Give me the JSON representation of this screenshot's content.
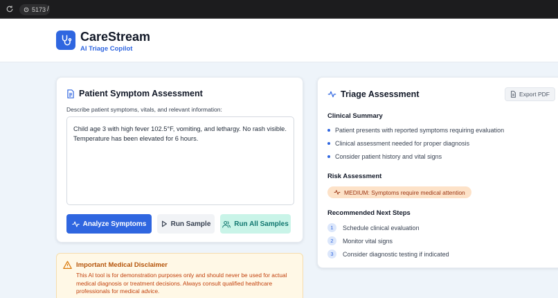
{
  "browser": {
    "port": "5173",
    "path": "/"
  },
  "header": {
    "title": "CareStream",
    "subtitle": "AI Triage Copilot"
  },
  "assessment_form": {
    "title": "Patient Symptom Assessment",
    "label": "Describe patient symptoms, vitals, and relevant information:",
    "input_value": "Child age 3 with high fever 102.5°F, vomiting, and lethargy. No rash visible. Temperature has been elevated for 6 hours.",
    "buttons": {
      "analyze": "Analyze Symptoms",
      "run_sample": "Run Sample",
      "run_all": "Run All Samples"
    }
  },
  "disclaimer": {
    "title": "Important Medical Disclaimer",
    "body": "This AI tool is for demonstration purposes only and should never be used for actual medical diagnosis or treatment decisions. Always consult qualified healthcare professionals for medical advice."
  },
  "triage": {
    "title": "Triage Assessment",
    "export_label": "Export PDF",
    "clinical_summary": {
      "heading": "Clinical Summary",
      "items": [
        "Patient presents with reported symptoms requiring evaluation",
        "Clinical assessment needed for proper diagnosis",
        "Consider patient history and vital signs"
      ]
    },
    "risk": {
      "heading": "Risk Assessment",
      "badge": "MEDIUM: Symptoms require medical attention"
    },
    "next_steps": {
      "heading": "Recommended Next Steps",
      "items": [
        {
          "num": "1",
          "text": "Schedule clinical evaluation"
        },
        {
          "num": "2",
          "text": "Monitor vital signs"
        },
        {
          "num": "3",
          "text": "Consider diagnostic testing if indicated"
        }
      ]
    }
  },
  "colors": {
    "primary": "#2f66e0",
    "teal_bg": "#c9f4e8",
    "warning_bg": "#fff8e6",
    "risk_bg": "#fde2c8"
  }
}
